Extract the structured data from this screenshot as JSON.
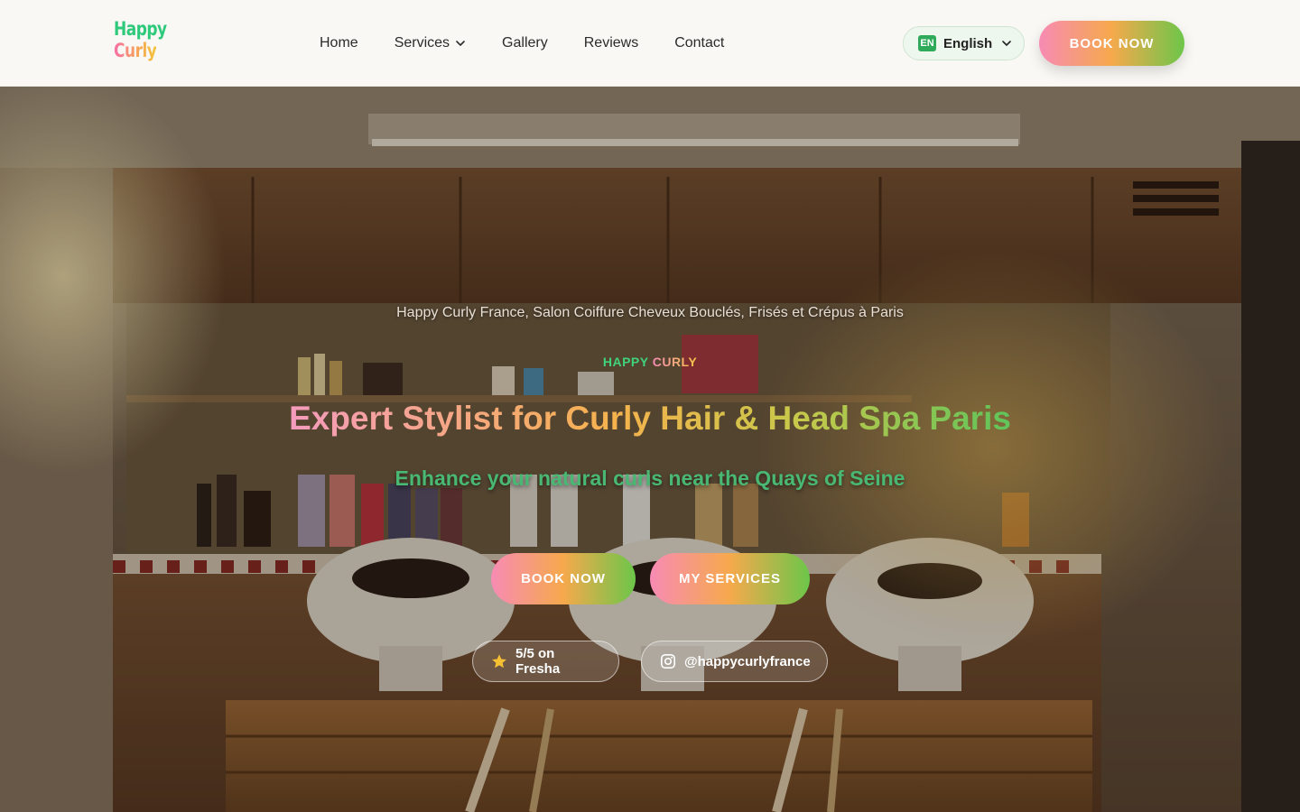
{
  "header": {
    "logo_top": "Happy",
    "logo_bottom": "Curly",
    "nav": [
      {
        "label": "Home",
        "icon": null
      },
      {
        "label": "Services",
        "icon": "chevron-down-icon"
      },
      {
        "label": "Gallery",
        "icon": null
      },
      {
        "label": "Reviews",
        "icon": null
      },
      {
        "label": "Contact",
        "icon": null
      }
    ],
    "language": {
      "code": "EN",
      "label": "English",
      "icon": "chevron-down-icon"
    },
    "book_label": "BOOK NOW"
  },
  "hero": {
    "tagline": "Happy Curly France, Salon Coiffure Cheveux Bouclés, Frisés et Crépus à Paris",
    "brand_part1": "HAPPY ",
    "brand_part2": "CURLY",
    "title": "Expert Stylist for Curly Hair & Head Spa Paris",
    "subtitle": "Enhance your natural curls near the Quays of Seine",
    "book_label": "BOOK NOW",
    "services_label": "MY SERVICES",
    "rating_label": "5/5 on Fresha",
    "rating_icon": "star-icon",
    "instagram_label": "@happycurlyfrance",
    "instagram_icon": "instagram-icon"
  },
  "colors": {
    "accent_green": "#48b873",
    "gradient_pink": "#f78bb4",
    "gradient_orange": "#f6a94c",
    "gradient_green": "#6cc64a",
    "star": "#f5c033"
  }
}
